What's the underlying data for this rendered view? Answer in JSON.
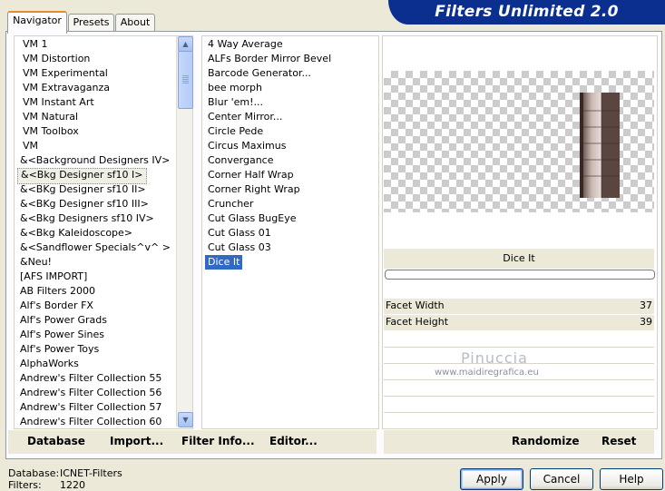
{
  "title": "Filters Unlimited 2.0",
  "tabs": [
    {
      "label": "Navigator",
      "active": true
    },
    {
      "label": "Presets",
      "active": false
    },
    {
      "label": "About",
      "active": false
    }
  ],
  "categories": [
    "VM 1",
    "VM Distortion",
    "VM Experimental",
    "VM Extravaganza",
    "VM Instant Art",
    "VM Natural",
    "VM Toolbox",
    "VM",
    "&<Background Designers IV>",
    "&<Bkg Designer sf10 I>",
    "&<BKg Designer sf10 II>",
    "&<BKg Designer sf10 III>",
    "&<Bkg Designers sf10 IV>",
    "&<Bkg Kaleidoscope>",
    "&<Sandflower Specials^v^ >",
    "&Neu!",
    "[AFS IMPORT]",
    "AB Filters 2000",
    "Alf's Border FX",
    "Alf's Power Grads",
    "Alf's Power Sines",
    "Alf's Power Toys",
    "AlphaWorks",
    "Andrew's Filter Collection 55",
    "Andrew's Filter Collection 56",
    "Andrew's Filter Collection 57",
    "Andrew's Filter Collection 60"
  ],
  "focused_category_index": 9,
  "filters": [
    "4 Way Average",
    "ALFs Border Mirror Bevel",
    "Barcode Generator...",
    "bee morph",
    "Blur 'em!...",
    "Center Mirror...",
    "Circle Pede",
    "Circus Maximus",
    "Convergance",
    "Corner Half Wrap",
    "Corner Right Wrap",
    "Cruncher",
    "Cut Glass  BugEye",
    "Cut Glass 01",
    "Cut Glass 03",
    "Dice It"
  ],
  "selected_filter_index": 15,
  "filter_name": "Dice It",
  "progress": 0,
  "parameters": [
    {
      "label": "Facet Width",
      "value": "37"
    },
    {
      "label": "Facet Height",
      "value": "39"
    }
  ],
  "watermark": {
    "line1": "Pinuccia",
    "line2": "www.maidiregrafica.eu"
  },
  "buttons": {
    "database": "Database",
    "import": "Import...",
    "filter_info": "Filter Info...",
    "editor": "Editor...",
    "randomize": "Randomize",
    "reset": "Reset",
    "apply": "Apply",
    "cancel": "Cancel",
    "help": "Help"
  },
  "status": {
    "database_label": "Database:",
    "database_value": "ICNET-Filters",
    "filters_label": "Filters:",
    "filters_value": "1220"
  },
  "colors": {
    "banner": "#0a2f8f",
    "selection": "#316ac5",
    "background": "#ece9d8",
    "tab_accent": "#e68b2c"
  },
  "icons": {
    "scroll_up": "chevron-up-icon",
    "scroll_down": "chevron-down-icon"
  }
}
